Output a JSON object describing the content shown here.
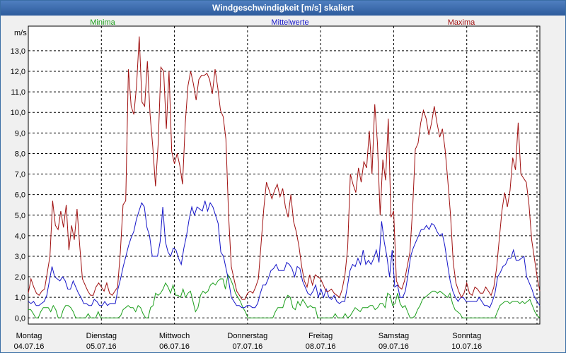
{
  "window": {
    "title": "Windgeschwindigkeit [m/s] skaliert"
  },
  "chart_data": {
    "type": "line",
    "title": "Windgeschwindigkeit [m/s] skaliert",
    "ylabel": "m/s",
    "ylim": [
      -0.3,
      14.2
    ],
    "yticks": [
      "0,0",
      "1,0",
      "2,0",
      "3,0",
      "4,0",
      "5,0",
      "6,0",
      "7,0",
      "8,0",
      "9,0",
      "10,0",
      "11,0",
      "12,0",
      "13,0"
    ],
    "x_labels": [
      {
        "day": "Montag",
        "date": "04.07.16"
      },
      {
        "day": "Dienstag",
        "date": "05.07.16"
      },
      {
        "day": "Mittwoch",
        "date": "06.07.16"
      },
      {
        "day": "Donnerstag",
        "date": "07.07.16"
      },
      {
        "day": "Freitag",
        "date": "08.07.16"
      },
      {
        "day": "Samstag",
        "date": "09.07.16"
      },
      {
        "day": "Sonntag",
        "date": "10.07.16"
      }
    ],
    "grid": true,
    "legend_position": "top",
    "series": [
      {
        "name": "Minima",
        "color": "#1a9e1a",
        "values": [
          0.4,
          0.4,
          0.2,
          0.0,
          0.0,
          0.3,
          0.5,
          0.5,
          0.5,
          0.3,
          0.6,
          0.4,
          0.0,
          0.0,
          0.4,
          0.6,
          0.6,
          0.5,
          0.3,
          0.0,
          0.0,
          0.0,
          0.0,
          0.0,
          0.2,
          0.0,
          0.0,
          0.0,
          0.3,
          0.0,
          0.0,
          0.0,
          0.0,
          0.0,
          0.0,
          0.0,
          0.0,
          0.1,
          0.4,
          0.5,
          0.6,
          0.5,
          0.5,
          0.3,
          0.6,
          0.5,
          0.2,
          0.0,
          0.0,
          0.5,
          0.6,
          1.2,
          1.1,
          1.2,
          1.4,
          1.7,
          1.5,
          1.2,
          1.6,
          1.1,
          1.1,
          1.0,
          1.4,
          1.0,
          1.2,
          1.3,
          0.8,
          0.3,
          0.5,
          1.1,
          1.3,
          1.2,
          1.3,
          1.6,
          1.7,
          1.6,
          1.8,
          1.9,
          1.9,
          1.4,
          2.1,
          1.9,
          1.6,
          1.2,
          1.0,
          0.8,
          0.5,
          0.3,
          0.0,
          0.0,
          0.0,
          0.0,
          0.0,
          0.0,
          0.0,
          0.0,
          0.0,
          0.0,
          0.0,
          0.3,
          0.5,
          0.5,
          0.5,
          0.9,
          1.1,
          1.0,
          0.5,
          0.4,
          0.8,
          0.6,
          0.9,
          0.7,
          0.5,
          0.6,
          0.5,
          0.5,
          0.0,
          0.0,
          0.0,
          0.0,
          0.0,
          0.0,
          0.0,
          0.2,
          0.0,
          0.0,
          0.0,
          0.2,
          0.0,
          0.1,
          0.3,
          0.5,
          0.4,
          0.3,
          0.5,
          0.5,
          0.5,
          0.6,
          0.6,
          0.4,
          0.5,
          0.7,
          0.7,
          0.5,
          1.2,
          1.1,
          0.6,
          0.7,
          1.2,
          0.7,
          0.5,
          0.6,
          0.3,
          0.0,
          0.0,
          0.1,
          0.4,
          0.6,
          0.9,
          1.0,
          1.1,
          1.2,
          1.3,
          1.3,
          1.2,
          1.3,
          1.2,
          1.1,
          1.0,
          1.2,
          0.7,
          0.4,
          0.3,
          0.2,
          0.0,
          0.0,
          0.0,
          0.0,
          0.0,
          0.0,
          0.0,
          0.0,
          0.0,
          0.0,
          0.0,
          0.0,
          0.0,
          0.0,
          0.3,
          0.6,
          0.7,
          0.8,
          0.8,
          0.7,
          0.8,
          0.8,
          0.8,
          0.7,
          0.8,
          0.7,
          0.8,
          0.9,
          0.6,
          0.3,
          0.1,
          0.0
        ]
      },
      {
        "name": "Mittelwerte",
        "color": "#1515c8",
        "values": [
          0.8,
          0.7,
          0.8,
          0.6,
          0.6,
          0.7,
          0.8,
          1.1,
          1.8,
          2.5,
          2.0,
          1.9,
          1.8,
          2.0,
          1.8,
          1.4,
          1.4,
          1.8,
          1.5,
          1.2,
          1.0,
          0.7,
          0.7,
          0.6,
          0.6,
          0.9,
          0.8,
          0.6,
          0.6,
          0.8,
          0.6,
          0.7,
          0.7,
          0.7,
          1.4,
          1.9,
          2.5,
          3.0,
          3.5,
          3.9,
          4.2,
          4.8,
          5.2,
          5.6,
          5.4,
          4.4,
          4.0,
          3.0,
          3.0,
          3.0,
          3.7,
          5.4,
          3.7,
          3.2,
          3.0,
          3.4,
          3.3,
          2.9,
          2.6,
          3.4,
          4.0,
          4.8,
          5.4,
          5.0,
          5.4,
          5.3,
          5.2,
          5.7,
          5.2,
          5.6,
          5.4,
          5.0,
          4.6,
          3.2,
          3.0,
          2.4,
          1.8,
          1.0,
          0.8,
          0.6,
          0.6,
          0.5,
          0.5,
          0.6,
          0.6,
          0.5,
          0.5,
          0.7,
          1.2,
          1.6,
          1.6,
          1.9,
          2.3,
          2.4,
          2.6,
          2.3,
          2.3,
          2.3,
          2.7,
          2.6,
          2.4,
          2.0,
          2.5,
          2.4,
          1.8,
          1.5,
          1.2,
          1.1,
          1.3,
          1.6,
          1.0,
          1.4,
          1.0,
          1.4,
          1.0,
          0.9,
          1.1,
          0.8,
          0.7,
          0.8,
          0.8,
          1.5,
          2.3,
          2.6,
          2.5,
          2.9,
          2.6,
          3.3,
          2.6,
          2.8,
          2.6,
          2.9,
          3.3,
          2.7,
          4.7,
          3.7,
          3.0,
          2.0,
          3.3,
          1.5,
          1.6,
          1.0,
          1.0,
          1.3,
          2.1,
          3.0,
          3.4,
          3.7,
          4.0,
          4.3,
          4.3,
          4.5,
          4.3,
          4.6,
          4.5,
          4.2,
          4.0,
          4.1,
          3.5,
          2.6,
          1.8,
          1.3,
          1.0,
          0.8,
          1.0,
          1.0,
          0.8,
          0.8,
          0.8,
          0.8,
          0.8,
          1.0,
          0.8,
          0.6,
          0.6,
          0.5,
          0.8,
          1.2,
          2.0,
          2.2,
          2.5,
          2.6,
          2.9,
          2.9,
          3.3,
          2.8,
          2.8,
          2.9,
          3.0,
          2.0,
          1.7,
          1.4,
          1.0,
          0.8,
          0.6
        ]
      },
      {
        "name": "Maxima",
        "color": "#a01010",
        "values": [
          1.2,
          1.9,
          1.5,
          1.2,
          1.1,
          1.3,
          1.4,
          2.2,
          3.0,
          5.7,
          4.5,
          4.3,
          5.2,
          4.4,
          5.5,
          3.3,
          4.5,
          3.8,
          5.3,
          3.5,
          1.9,
          1.6,
          1.3,
          1.1,
          1.1,
          1.5,
          1.7,
          1.5,
          1.3,
          1.7,
          1.2,
          1.1,
          1.3,
          1.5,
          3.2,
          5.5,
          5.7,
          12.1,
          10.3,
          9.9,
          11.3,
          13.7,
          10.5,
          10.3,
          12.5,
          9.9,
          8.3,
          6.4,
          8.5,
          12.2,
          12.0,
          9.2,
          12.0,
          8.1,
          7.5,
          8.0,
          7.4,
          6.5,
          9.5,
          11.3,
          12.0,
          11.4,
          10.6,
          11.6,
          11.8,
          11.8,
          11.9,
          11.6,
          10.9,
          12.1,
          11.2,
          10.1,
          9.8,
          8.7,
          5.0,
          2.5,
          1.9,
          1.3,
          1.1,
          0.9,
          0.9,
          1.2,
          1.3,
          1.2,
          1.5,
          1.9,
          3.6,
          5.3,
          6.6,
          6.2,
          5.8,
          6.2,
          6.5,
          5.9,
          6.3,
          5.4,
          4.9,
          6.0,
          4.7,
          4.2,
          3.5,
          2.5,
          1.8,
          1.5,
          2.1,
          1.6,
          2.1,
          2.0,
          1.9,
          1.6,
          1.3,
          1.3,
          1.4,
          1.2,
          1.1,
          1.0,
          1.4,
          2.1,
          3.4,
          7.0,
          6.5,
          6.1,
          7.3,
          6.6,
          7.6,
          7.3,
          9.1,
          7.0,
          10.4,
          8.5,
          5.0,
          7.7,
          6.7,
          9.7,
          4.9,
          5.2,
          1.8,
          1.5,
          1.4,
          1.8,
          2.5,
          3.2,
          5.3,
          8.2,
          8.5,
          9.5,
          10.1,
          9.7,
          8.9,
          9.5,
          10.3,
          9.5,
          8.8,
          9.2,
          8.2,
          6.7,
          5.0,
          2.7,
          1.7,
          1.3,
          1.0,
          1.2,
          1.7,
          1.2,
          1.1,
          1.5,
          1.4,
          1.2,
          1.2,
          1.5,
          1.3,
          1.1,
          1.5,
          2.4,
          3.8,
          5.2,
          6.1,
          5.4,
          6.2,
          7.8,
          7.2,
          9.5,
          7.0,
          6.8,
          6.6,
          5.5,
          3.8,
          2.9,
          2.0,
          1.3
        ]
      }
    ]
  }
}
